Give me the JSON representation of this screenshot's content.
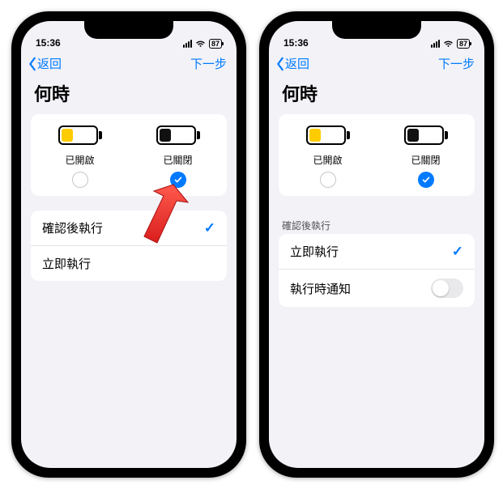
{
  "status": {
    "time": "15:36",
    "battery": "87"
  },
  "nav": {
    "back": "返回",
    "next": "下一步"
  },
  "title": "何時",
  "battery_options": {
    "on_label": "已開啟",
    "off_label": "已關閉"
  },
  "left_phone": {
    "rows": {
      "confirm": "確認後執行",
      "immediate": "立即執行"
    }
  },
  "right_phone": {
    "confirm_peek": "確認後執行",
    "rows": {
      "immediate": "立即執行",
      "notify": "執行時通知"
    }
  }
}
